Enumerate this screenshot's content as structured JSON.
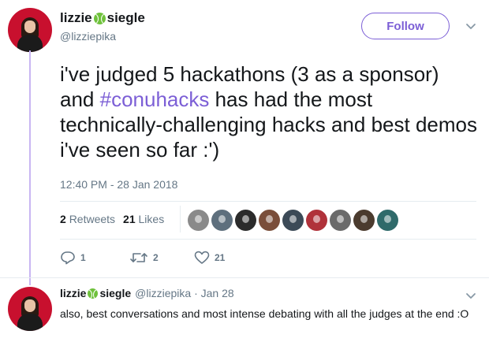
{
  "tweet": {
    "author": {
      "name_part1": "lizzie",
      "name_part2": "siegle",
      "handle": "@lizziepika"
    },
    "follow_label": "Follow",
    "text_before": "i've judged 5 hackathons (3 as a sponsor) and ",
    "hashtag": "#conuhacks",
    "text_after": " has had the most technically-challenging hacks and best demos i've seen so far :')",
    "timestamp": "12:40 PM - 28 Jan 2018",
    "retweets_count": "2",
    "retweets_label": "Retweets",
    "likes_count": "21",
    "likes_label": "Likes",
    "actions": {
      "reply_count": "1",
      "retweet_count": "2",
      "like_count": "21"
    },
    "liker_colors": [
      "#8a8a8a",
      "#5e6f7d",
      "#2b2b2b",
      "#7a4e3a",
      "#3c4a57",
      "#b0323a",
      "#6a6a6a",
      "#4b3b2e",
      "#2f6a6a"
    ]
  },
  "reply": {
    "author": {
      "name_part1": "lizzie",
      "name_part2": "siegle",
      "handle": "@lizziepika"
    },
    "separator": " · ",
    "date": "Jan 28",
    "text": "also, best conversations and most intense debating with all the judges at the end :O"
  },
  "colors": {
    "accent": "#7c5fd6",
    "muted": "#657786",
    "text": "#14171a",
    "thread": "#c9b6f2"
  }
}
